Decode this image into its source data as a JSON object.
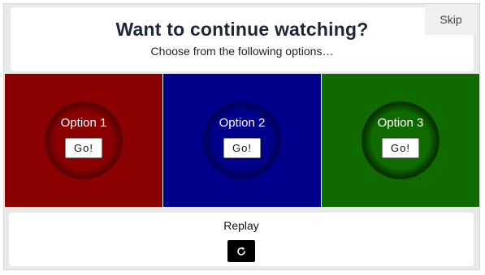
{
  "header": {
    "title": "Want to continue watching?",
    "subtitle": "Choose from the following options…",
    "skip_label": "Skip"
  },
  "options": [
    {
      "label": "Option 1",
      "button_label": "Go!",
      "color": "#8b0000",
      "glow_color": "#5a0000"
    },
    {
      "label": "Option 2",
      "button_label": "Go!",
      "color": "#00008b",
      "glow_color": "#00005a"
    },
    {
      "label": "Option 3",
      "button_label": "Go!",
      "color": "#0f6b00",
      "glow_color": "#063000"
    }
  ],
  "replay": {
    "label": "Replay",
    "icon": "replay-icon"
  },
  "colors": {
    "frame_background": "#e9e9e9",
    "title_color": "#1b2838",
    "replay_button": "#000000"
  }
}
